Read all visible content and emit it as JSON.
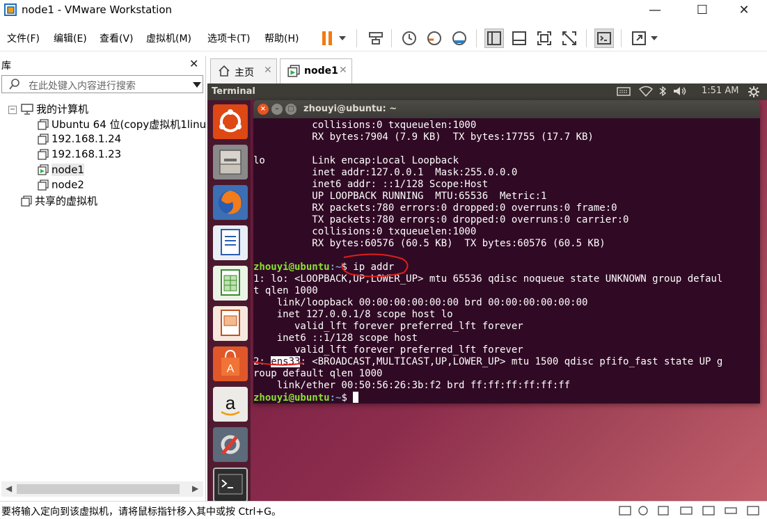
{
  "window": {
    "title": "node1 - VMware Workstation",
    "controls": [
      "—",
      "☐",
      "✕"
    ]
  },
  "menu": {
    "items": [
      "文件(F)",
      "编辑(E)",
      "查看(V)",
      "虚拟机(M)",
      "选项卡(T)",
      "帮助(H)"
    ]
  },
  "library": {
    "title": "库",
    "close": "✕",
    "search_placeholder": "在此处键入内容进行搜索",
    "tree": {
      "root": "我的计算机",
      "items": [
        "Ubuntu 64 位(copy虚拟机1linu",
        "192.168.1.24",
        "192.168.1.23",
        "node1",
        "node2"
      ],
      "shared": "共享的虚拟机"
    }
  },
  "tabs": [
    {
      "label": "主页",
      "close": "✕"
    },
    {
      "label": "node1",
      "close": "✕"
    }
  ],
  "vm": {
    "topbar_title": "Terminal",
    "clock": "1:51 AM",
    "terminal": {
      "title": "zhouyi@ubuntu: ~",
      "lines": [
        {
          "text": "          collisions:0 txqueuelen:1000"
        },
        {
          "text": "          RX bytes:7904 (7.9 KB)  TX bytes:17755 (17.7 KB)"
        },
        {
          "text": ""
        },
        {
          "text": "lo        Link encap:Local Loopback"
        },
        {
          "text": "          inet addr:127.0.0.1  Mask:255.0.0.0"
        },
        {
          "text": "          inet6 addr: ::1/128 Scope:Host"
        },
        {
          "text": "          UP LOOPBACK RUNNING  MTU:65536  Metric:1"
        },
        {
          "text": "          RX packets:780 errors:0 dropped:0 overruns:0 frame:0"
        },
        {
          "text": "          TX packets:780 errors:0 dropped:0 overruns:0 carrier:0"
        },
        {
          "text": "          collisions:0 txqueuelen:1000"
        },
        {
          "text": "          RX bytes:60576 (60.5 KB)  TX bytes:60576 (60.5 KB)"
        },
        {
          "text": ""
        },
        {
          "prompt_user": "zhouyi@ubuntu",
          "prompt_path": ":~",
          "prompt_end": "$ ",
          "cmd": "ip addr"
        },
        {
          "text": "1: lo: <LOOPBACK,UP,LOWER_UP> mtu 65536 qdisc noqueue state UNKNOWN group defaul"
        },
        {
          "text": "t qlen 1000"
        },
        {
          "text": "    link/loopback 00:00:00:00:00:00 brd 00:00:00:00:00:00"
        },
        {
          "text": "    inet 127.0.0.1/8 scope host lo"
        },
        {
          "text": "       valid_lft forever preferred_lft forever"
        },
        {
          "text": "    inet6 ::1/128 scope host"
        },
        {
          "text": "       valid_lft forever preferred_lft forever"
        },
        {
          "pre": "2: ",
          "highlight": "ens33",
          "post": ": <BROADCAST,MULTICAST,UP,LOWER_UP> mtu 1500 qdisc pfifo_fast state UP g"
        },
        {
          "text": "roup default qlen 1000"
        },
        {
          "text": "    link/ether 00:50:56:26:3b:f2 brd ff:ff:ff:ff:ff:ff"
        },
        {
          "prompt_user": "zhouyi@ubuntu",
          "prompt_path": ":~",
          "prompt_end": "$ ",
          "cmd": "",
          "cursor": true
        }
      ]
    }
  },
  "status": {
    "text": "要将输入定向到该虚拟机，请将鼠标指针移入其中或按 Ctrl+G。"
  },
  "colors": {
    "terminal_bg": "#300a24",
    "prompt_user": "#8ae234",
    "prompt_path": "#729fcf",
    "annotation": "#e0201a"
  }
}
